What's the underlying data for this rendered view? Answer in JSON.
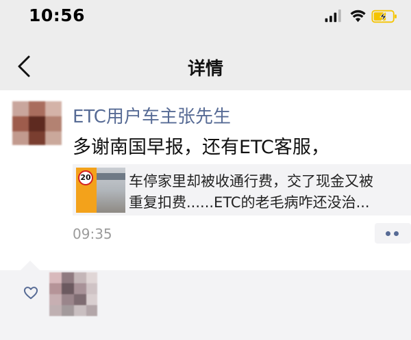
{
  "status_bar": {
    "time": "10:56"
  },
  "nav": {
    "title": "详情"
  },
  "post": {
    "author": "ETC用户车主张先生",
    "text": "多谢南国早报，还有ETC客服，",
    "link_card": {
      "title_line1": "车停家里却被收通行费，交了现金又被",
      "title_line2": "重复扣费......ETC的老毛病咋还没治...",
      "thumbnail_sign": "20"
    },
    "time": "09:35"
  },
  "colors": {
    "link_blue": "#576b95",
    "header_bg": "#ededed",
    "card_bg": "#f3f3f5",
    "battery_yellow": "#f5c400"
  },
  "icons": {
    "back": "chevron-left-icon",
    "signal": "signal-icon",
    "wifi": "wifi-icon",
    "battery": "battery-charging-icon",
    "more": "more-dots-icon",
    "like": "heart-icon"
  }
}
